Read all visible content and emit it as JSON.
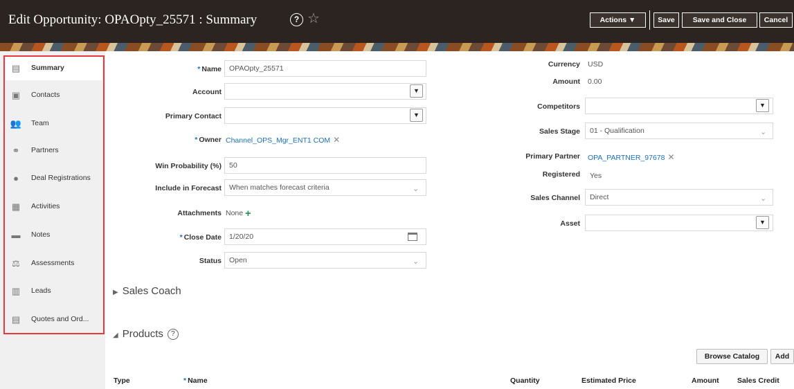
{
  "header": {
    "title": "Edit Opportunity: OPAOpty_25571 : Summary",
    "actions_label": "Actions",
    "save_label": "Save",
    "save_close_label": "Save and Close",
    "cancel_label": "Cancel"
  },
  "sidebar": {
    "items": [
      {
        "label": "Summary",
        "icon": "summary-icon"
      },
      {
        "label": "Contacts",
        "icon": "contacts-icon"
      },
      {
        "label": "Team",
        "icon": "team-icon"
      },
      {
        "label": "Partners",
        "icon": "partners-icon"
      },
      {
        "label": "Deal Registrations",
        "icon": "deal-registrations-icon"
      },
      {
        "label": "Activities",
        "icon": "activities-icon"
      },
      {
        "label": "Notes",
        "icon": "notes-icon"
      },
      {
        "label": "Assessments",
        "icon": "assessments-icon"
      },
      {
        "label": "Leads",
        "icon": "leads-icon"
      },
      {
        "label": "Quotes and Ord...",
        "icon": "quotes-icon"
      }
    ]
  },
  "form": {
    "name": {
      "label": "Name",
      "value": "OPAOpty_25571"
    },
    "account": {
      "label": "Account",
      "value": ""
    },
    "primary_contact": {
      "label": "Primary Contact",
      "value": ""
    },
    "owner": {
      "label": "Owner",
      "value": "Channel_OPS_Mgr_ENT1 COM"
    },
    "win_probability": {
      "label": "Win Probability (%)",
      "value": "50"
    },
    "include_in_forecast": {
      "label": "Include in Forecast",
      "value": "When matches forecast criteria"
    },
    "attachments": {
      "label": "Attachments",
      "value": "None"
    },
    "close_date": {
      "label": "Close Date",
      "value": "1/20/20"
    },
    "status": {
      "label": "Status",
      "value": "Open"
    },
    "currency": {
      "label": "Currency",
      "value": "USD"
    },
    "amount": {
      "label": "Amount",
      "value": "0.00"
    },
    "competitors": {
      "label": "Competitors",
      "value": ""
    },
    "sales_stage": {
      "label": "Sales Stage",
      "value": "01 - Qualification"
    },
    "primary_partner": {
      "label": "Primary Partner",
      "value": "OPA_PARTNER_97678"
    },
    "registered": {
      "label": "Registered",
      "value": "Yes"
    },
    "sales_channel": {
      "label": "Sales Channel",
      "value": "Direct"
    },
    "asset": {
      "label": "Asset",
      "value": ""
    }
  },
  "sections": {
    "sales_coach": "Sales Coach",
    "products": "Products"
  },
  "products": {
    "browse_catalog_label": "Browse Catalog",
    "add_label": "Add",
    "columns": [
      "Type",
      "Name",
      "Quantity",
      "Estimated Price",
      "Amount",
      "Sales Credit"
    ]
  },
  "colors": {
    "header_bg": "#2b2420",
    "link": "#1c70b8",
    "highlight_border": "#e8383d"
  }
}
